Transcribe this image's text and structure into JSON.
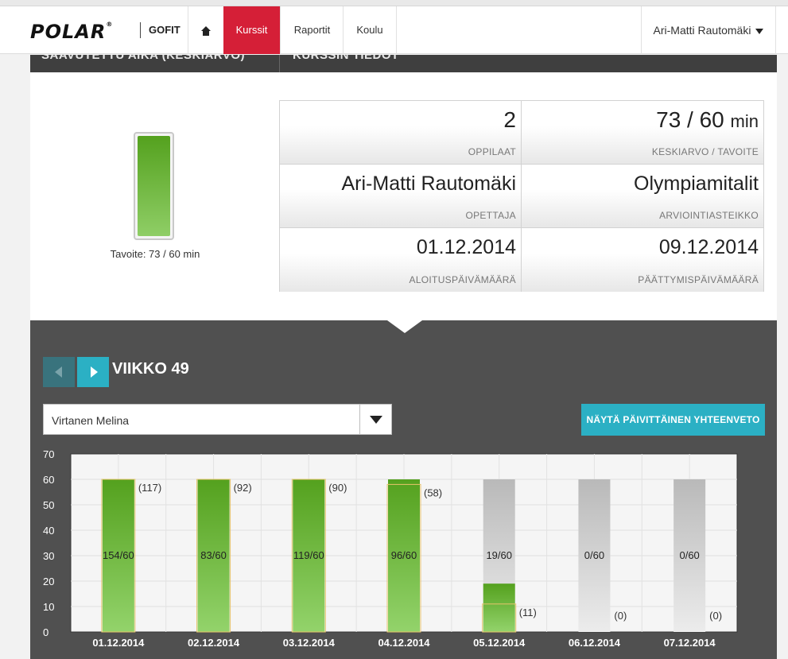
{
  "nav": {
    "logo": "POLAR",
    "logo_reg": "®",
    "product": "GOFIT",
    "home_icon": "home-icon",
    "tabs": [
      "Kurssit",
      "Raportit",
      "Koulu"
    ],
    "active_tab": "Kurssit",
    "user": "Ari-Matti Rautomäki"
  },
  "section_headers": [
    "SAAVUTETTU AIKA (KESKIARVO)",
    "KURSSIN TIEDOT"
  ],
  "gauge": {
    "label": "Tavoite: 73 / 60 min",
    "level": 1.0
  },
  "course_info": {
    "students_value": "2",
    "students_label": "OPPILAAT",
    "avg_value": "73 / 60",
    "avg_unit": "min",
    "avg_label": "KESKIARVO / TAVOITE",
    "teacher_value": "Ari-Matti Rautomäki",
    "teacher_label": "OPETTAJA",
    "scale_value": "Olympiamitalit",
    "scale_label": "ARVIOINTIASTEIKKO",
    "start_value": "01.12.2014",
    "start_label": "ALOITUSPÄIVÄMÄÄRÄ",
    "end_value": "09.12.2014",
    "end_label": "PÄÄTTYMISPÄIVÄMÄÄRÄ"
  },
  "week_nav": {
    "title": "VIIKKO 49",
    "prev_icon": "chevron-left-icon",
    "next_icon": "chevron-right-icon"
  },
  "student_select": {
    "value": "Virtanen Melina",
    "icon": "chevron-down-icon"
  },
  "summary_button": "NÄYTÄ PÄIVITTÄINEN YHTEENVETO",
  "colors": {
    "accent_red": "#d51f37",
    "teal": "#2bb0c4",
    "bar_green": "#54a11e",
    "bar_gray": "#b9b9b9",
    "outline_yellow": "#e6c36a"
  },
  "chart_data": {
    "type": "bar",
    "ylim": [
      0,
      70
    ],
    "yticks": [
      0,
      10,
      20,
      30,
      40,
      50,
      60,
      70
    ],
    "grid": true,
    "categories": [
      "01.12.2014",
      "02.12.2014",
      "03.12.2014",
      "04.12.2014",
      "05.12.2014",
      "06.12.2014",
      "07.12.2014"
    ],
    "goal": 60,
    "values": [
      60,
      60,
      60,
      60,
      19,
      0,
      0
    ],
    "ratio_labels": [
      "154/60",
      "83/60",
      "119/60",
      "96/60",
      "19/60",
      "0/60",
      "0/60"
    ],
    "outline_values": [
      117,
      92,
      90,
      58,
      11,
      0,
      0
    ],
    "outline_labels": [
      "(117)",
      "(92)",
      "(90)",
      "(58)",
      "(11)",
      "(0)",
      "(0)"
    ]
  }
}
